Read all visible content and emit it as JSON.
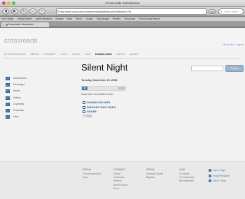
{
  "browser": {
    "window_title": "Crossroads: Introduction",
    "url": "http://www.crossroads.net/my/media/playMedia.php?&MediaId=794",
    "search_placeholder": "Yahoo Search",
    "back": "◀",
    "forward": "▶",
    "reload": "↻",
    "home": "⌂",
    "add": "+",
    "go": "G▾",
    "bookmarks": [
      "Most Visited",
      "Getting Started",
      "Latest Headlines",
      "Amazon",
      "eBay",
      "Yahoo!",
      "Google",
      "Daily Images",
      "Reuters",
      "Crossroads",
      "Final Scoring Results"
    ],
    "tab": {
      "label": "Crossroads: Introduction",
      "close": "×"
    }
  },
  "header": {
    "logo": "crossroads",
    "profile_link": "My Profile / Logout"
  },
  "main_nav": [
    "MY CROSSROADS",
    "SERVE",
    "CONNECT",
    "CARE",
    "GROW",
    "GIVE",
    "DOWNLOADS",
    "ABOUT",
    "ADMIN"
  ],
  "main_nav_active": "DOWNLOADS",
  "search": {
    "button": "Search"
  },
  "page_title": "Silent Night",
  "sidebar": [
    "Introduction",
    "Messages",
    "Music",
    "Videos",
    "Channels",
    "Podcasts",
    "Help"
  ],
  "content": {
    "date": "Tuesday, November 25, 2008",
    "description": "Music from the Awaited show.",
    "actions": [
      "DOWNLOAD MP3",
      "DISCUSS THIS VIDEO",
      "SHARE"
    ],
    "share_widget": "Share"
  },
  "footer": {
    "columns": [
      {
        "heading": "SERVE",
        "links": [
          "Find Involvement",
          "More..."
        ]
      },
      {
        "heading": "CONNECT",
        "links": [
          "Forum",
          "Confessed",
          "Parents",
          "Small Groups",
          "More..."
        ]
      },
      {
        "heading": "GROW",
        "links": [
          "Spiritual Growth",
          "Baptism"
        ]
      },
      {
        "heading": "GIVE",
        "links": [
          "To Others",
          "To Crossroads",
          "My Statement"
        ]
      }
    ],
    "extras": [
      "Top of Page",
      "Prayer Request",
      "Get In Touch"
    ]
  },
  "colors": {
    "accent": "#4a7fb8",
    "link": "#2e5c8e",
    "logo": "#a5a5a5"
  }
}
